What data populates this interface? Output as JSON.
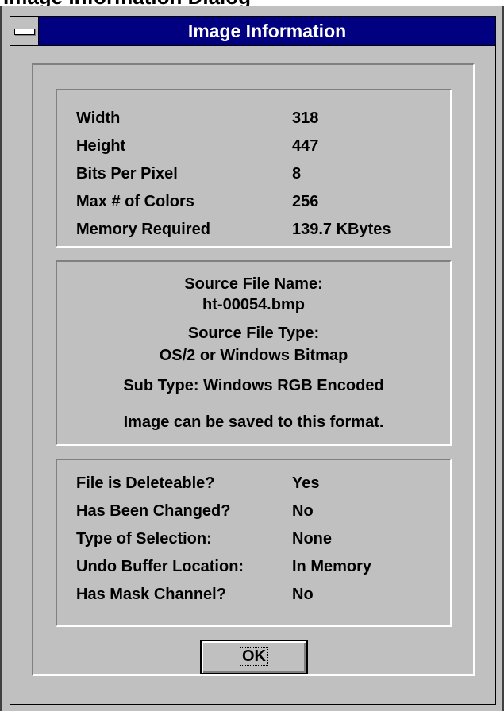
{
  "background_title": "Image Information Dialog",
  "window": {
    "title": "Image Information"
  },
  "image_stats": [
    {
      "label": "Width",
      "value": "318"
    },
    {
      "label": "Height",
      "value": "447"
    },
    {
      "label": "Bits Per Pixel",
      "value": "8"
    },
    {
      "label": "Max # of Colors",
      "value": "256"
    },
    {
      "label": "Memory Required",
      "value": "139.7 KBytes"
    }
  ],
  "source": {
    "name_label": "Source File Name:",
    "name_value": "ht-00054.bmp",
    "type_label": "Source File Type:",
    "type_value": "OS/2 or Windows Bitmap",
    "sub_type": "Sub Type: Windows RGB Encoded",
    "save_note": "Image can be saved to this format."
  },
  "file_status": [
    {
      "label": "File is Deleteable?",
      "value": "Yes"
    },
    {
      "label": "Has Been Changed?",
      "value": "No"
    },
    {
      "label": "Type of Selection:",
      "value": "None"
    },
    {
      "label": "Undo Buffer Location:",
      "value": "In Memory"
    },
    {
      "label": "Has Mask Channel?",
      "value": "No"
    }
  ],
  "ok_label": "OK"
}
